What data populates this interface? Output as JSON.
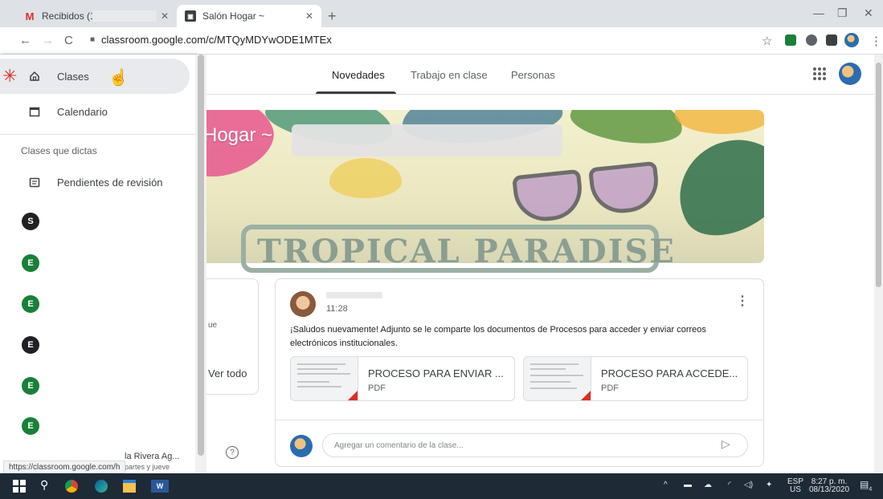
{
  "browser": {
    "tabs": [
      {
        "title": "Recibidos (1) -",
        "active": false,
        "favicon": "gmail-icon"
      },
      {
        "title": "Salón Hogar ~",
        "active": true,
        "favicon": "classroom-icon"
      }
    ],
    "url": "classroom.google.com/c/MTQyMDYwODE1MTEx",
    "status_url": "https://classroom.google.com/h"
  },
  "header": {
    "tabs": [
      {
        "label": "Novedades",
        "active": true
      },
      {
        "label": "Trabajo en clase",
        "active": false
      },
      {
        "label": "Personas",
        "active": false
      }
    ]
  },
  "sidebar": {
    "items": [
      {
        "label": "Clases",
        "icon": "home-icon",
        "active": true
      },
      {
        "label": "Calendario",
        "icon": "calendar-icon",
        "active": false
      }
    ],
    "section_title": "Clases que dictas",
    "review_label": "Pendientes de revisión",
    "classes": [
      {
        "initial": "S",
        "color": "#202124"
      },
      {
        "initial": "E",
        "color": "#188038"
      },
      {
        "initial": "E",
        "color": "#188038"
      },
      {
        "initial": "E",
        "color": "#202124"
      },
      {
        "initial": "E",
        "color": "#188038"
      },
      {
        "initial": "E",
        "color": "#188038"
      }
    ],
    "partial_text": "la Rivera Ag...",
    "partial_sub": "partes y jueve"
  },
  "banner": {
    "title": "Hogar ~",
    "image_text": "TROPICAL PARADISE"
  },
  "upcoming": {
    "partial_text": "ue",
    "view_all": "Ver todo"
  },
  "post": {
    "time": "11:28",
    "text": "¡Saludos nuevamente! Adjunto se le comparte los documentos de Procesos para acceder y enviar correos electrónicos institucionales.",
    "attachments": [
      {
        "name": "PROCESO PARA ENVIAR ...",
        "type": "PDF"
      },
      {
        "name": "PROCESO PARA ACCEDE...",
        "type": "PDF"
      }
    ],
    "comment_placeholder": "Agregar un comentario de la clase..."
  },
  "taskbar": {
    "lang_top": "ESP",
    "lang_bottom": "US",
    "time": "8:27 p. m.",
    "date": "08/13/2020",
    "notifications": "4"
  },
  "colors": {
    "accent": "#1967d2",
    "active_nav": "#e8eaed",
    "green_class": "#188038",
    "dark_class": "#202124",
    "pdf_red": "#d93025"
  }
}
